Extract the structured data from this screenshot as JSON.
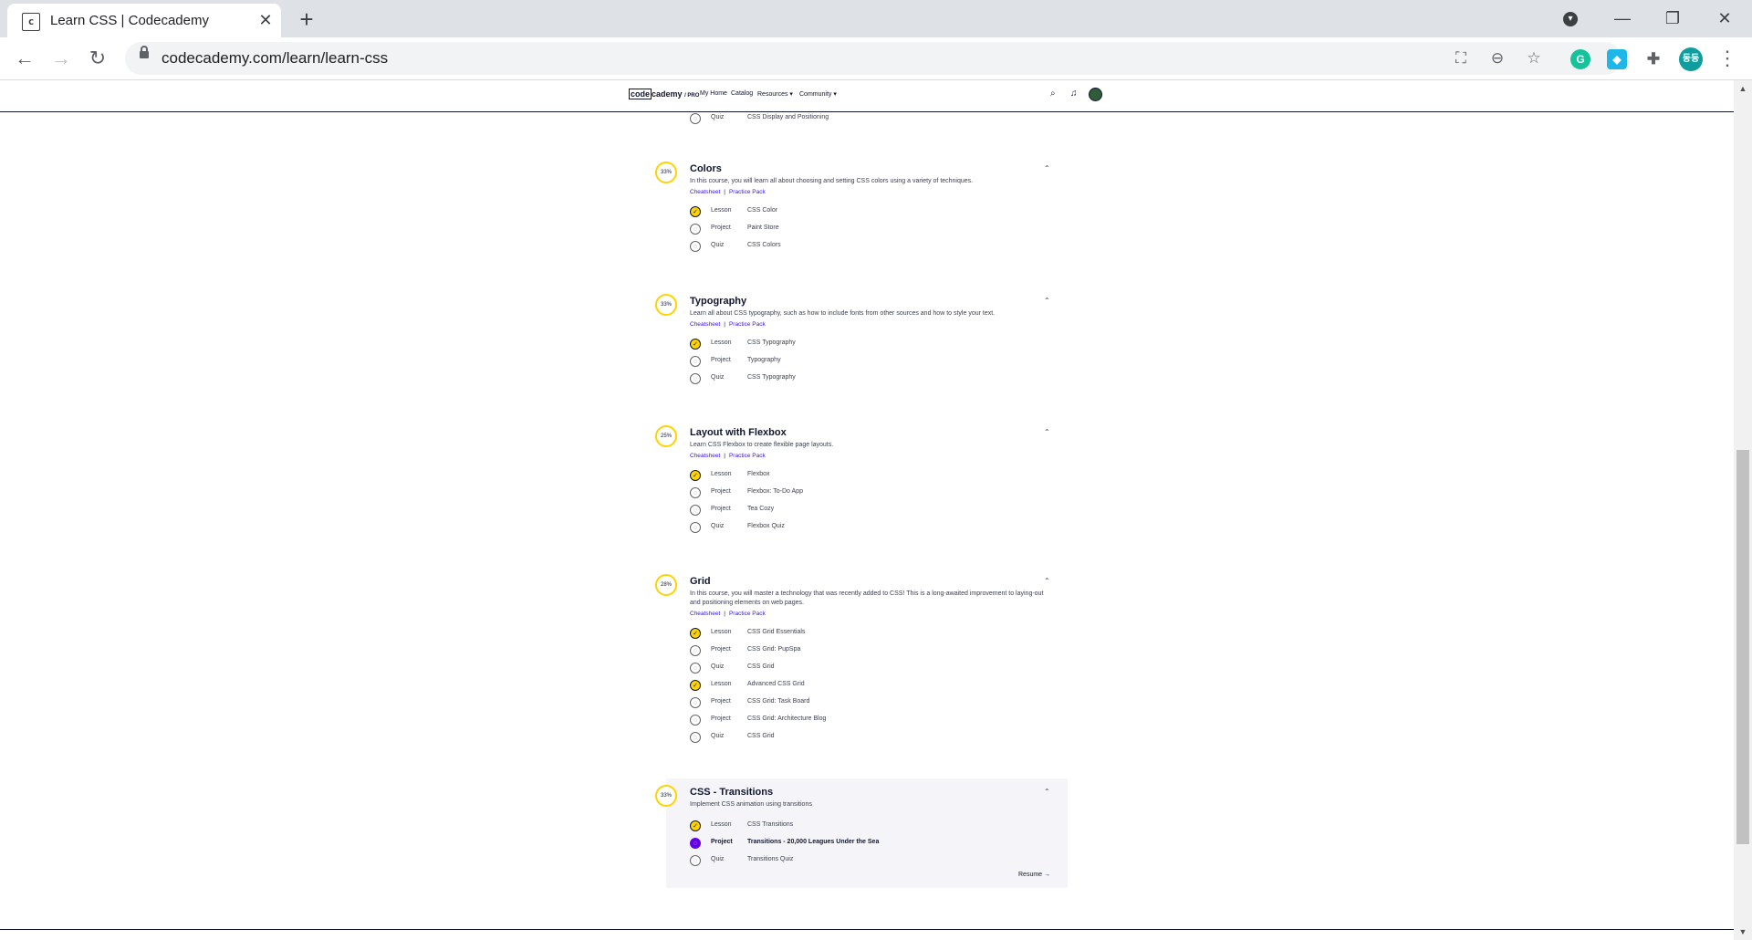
{
  "browser": {
    "tab_title": "Learn CSS | Codecademy",
    "favicon_text": "c",
    "url": "codecademy.com/learn/learn-css",
    "profile_initials": "동동"
  },
  "site_header": {
    "logo_box": "code",
    "logo_rest": "cademy",
    "logo_pro": "/ PRO",
    "nav": [
      "My Home",
      "Catalog",
      "Resources ▾",
      "Community ▾"
    ]
  },
  "top_partial_row": {
    "type": "Quiz",
    "name": "CSS Display and Positioning"
  },
  "modules": [
    {
      "progress": "33%",
      "title": "Colors",
      "description": "In this course, you will learn all about choosing and setting CSS colors using a variety of techniques.",
      "links": [
        "Cheatsheet",
        "Practice Pack"
      ],
      "items": [
        {
          "type": "Lesson",
          "name": "CSS Color",
          "status": "done"
        },
        {
          "type": "Project",
          "name": "Paint Store",
          "status": "todo"
        },
        {
          "type": "Quiz",
          "name": "CSS Colors",
          "status": "todo"
        }
      ]
    },
    {
      "progress": "33%",
      "title": "Typography",
      "description": "Learn all about CSS typography, such as how to include fonts from other sources and how to style your text.",
      "links": [
        "Cheatsheet",
        "Practice Pack"
      ],
      "items": [
        {
          "type": "Lesson",
          "name": "CSS Typography",
          "status": "done"
        },
        {
          "type": "Project",
          "name": "Typography",
          "status": "todo"
        },
        {
          "type": "Quiz",
          "name": "CSS Typography",
          "status": "todo"
        }
      ]
    },
    {
      "progress": "25%",
      "title": "Layout with Flexbox",
      "description": "Learn CSS Flexbox to create flexible page layouts.",
      "links": [
        "Cheatsheet",
        "Practice Pack"
      ],
      "items": [
        {
          "type": "Lesson",
          "name": "Flexbox",
          "status": "done"
        },
        {
          "type": "Project",
          "name": "Flexbox: To-Do App",
          "status": "todo"
        },
        {
          "type": "Project",
          "name": "Tea Cozy",
          "status": "todo"
        },
        {
          "type": "Quiz",
          "name": "Flexbox Quiz",
          "status": "todo"
        }
      ]
    },
    {
      "progress": "28%",
      "title": "Grid",
      "description": "In this course, you will master a technology that was recently added to CSS! This is a long-awaited improvement to laying-out and positioning elements on web pages.",
      "links": [
        "Cheatsheet",
        "Practice Pack"
      ],
      "items": [
        {
          "type": "Lesson",
          "name": "CSS Grid Essentials",
          "status": "done"
        },
        {
          "type": "Project",
          "name": "CSS Grid: PupSpa",
          "status": "todo"
        },
        {
          "type": "Quiz",
          "name": "CSS Grid",
          "status": "todo"
        },
        {
          "type": "Lesson",
          "name": "Advanced CSS Grid",
          "status": "done"
        },
        {
          "type": "Project",
          "name": "CSS Grid: Task Board",
          "status": "todo"
        },
        {
          "type": "Project",
          "name": "CSS Grid: Architecture Blog",
          "status": "todo"
        },
        {
          "type": "Quiz",
          "name": "CSS Grid",
          "status": "todo"
        }
      ]
    },
    {
      "progress": "33%",
      "title": "CSS - Transitions",
      "description": "Implement CSS animation using transitions",
      "links": [],
      "items": [
        {
          "type": "Lesson",
          "name": "CSS Transitions",
          "status": "done"
        },
        {
          "type": "Project",
          "name": "Transitions - 20,000 Leagues Under the Sea",
          "status": "active"
        },
        {
          "type": "Quiz",
          "name": "Transitions Quiz",
          "status": "todo"
        }
      ],
      "resume_label": "Resume →"
    }
  ],
  "icons": {
    "done": "✓",
    "todo": "◌",
    "active": "◌",
    "chevron": "⌃"
  },
  "colors": {
    "progress_ring": "#ffd300",
    "link": "#3a10e5",
    "active_item": "#6400e4",
    "ink": "#10162f"
  }
}
